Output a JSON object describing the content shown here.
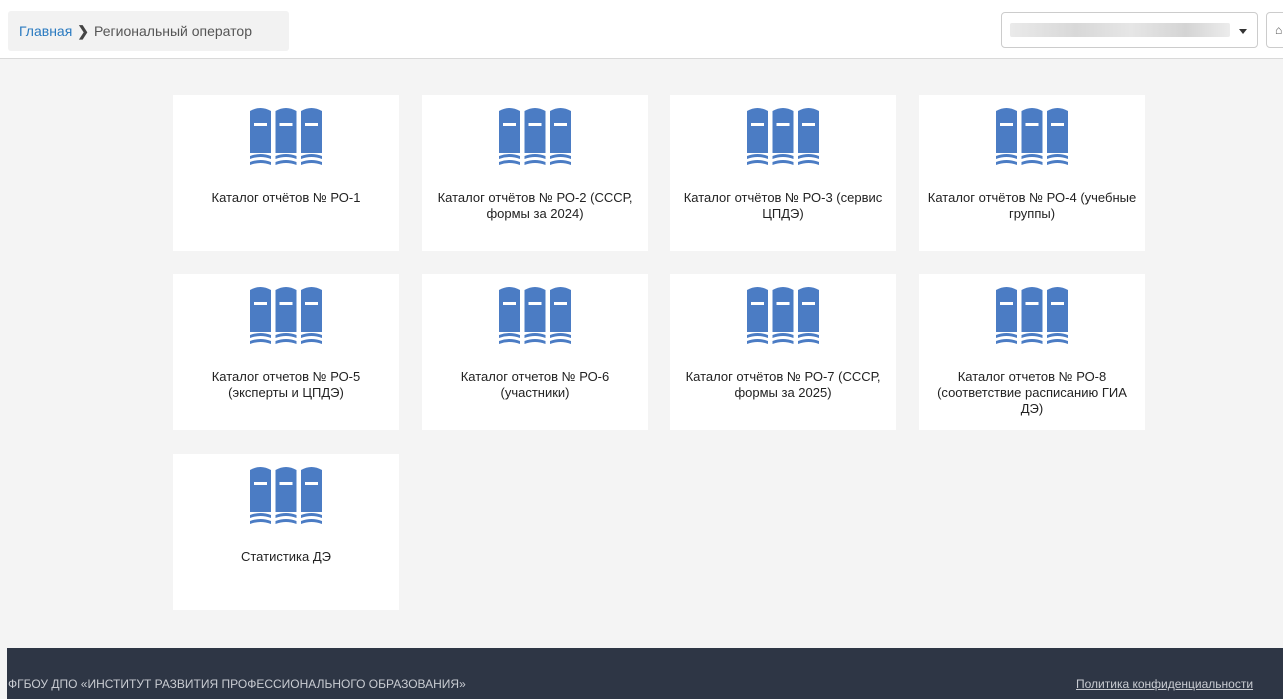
{
  "breadcrumb": {
    "home": "Главная",
    "separator": "❯",
    "current": "Региональный оператор"
  },
  "header": {
    "select_value": "",
    "edge_button": "⌂"
  },
  "icon": {
    "name": "books-icon",
    "color": "#4b7cc4"
  },
  "cards": [
    {
      "label": "Каталог отчётов № РО-1"
    },
    {
      "label": "Каталог отчётов № РО-2 (СССР, формы за 2024)"
    },
    {
      "label": "Каталог отчётов № РО-3 (сервис ЦПДЭ)"
    },
    {
      "label": "Каталог отчётов № РО-4 (учебные группы)"
    },
    {
      "label": "Каталог отчетов № РО-5 (эксперты и ЦПДЭ)"
    },
    {
      "label": "Каталог отчетов № РО-6 (участники)"
    },
    {
      "label": "Каталог отчётов № РО-7 (СССР, формы за 2025)"
    },
    {
      "label": "Каталог отчетов № РО-8 (соответствие расписанию ГИА ДЭ)"
    },
    {
      "label": "Статистика ДЭ"
    }
  ],
  "footer": {
    "organization": "ФГБОУ ДПО «ИНСТИТУТ РАЗВИТИЯ ПРОФЕССИОНАЛЬНОГО ОБРАЗОВАНИЯ»",
    "privacy_link": "Политика конфиденциальности"
  }
}
